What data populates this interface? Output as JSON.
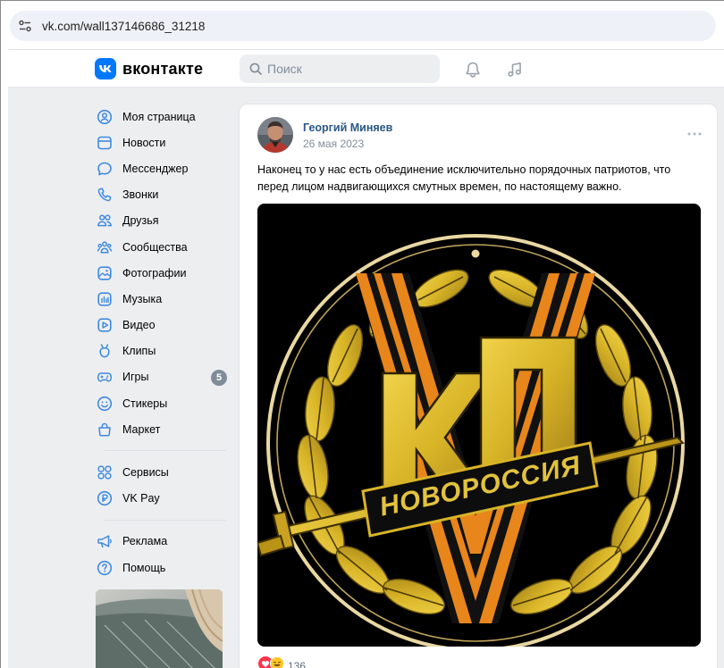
{
  "browser": {
    "url": "vk.com/wall137146686_31218"
  },
  "header": {
    "logo_text": "вконтакте",
    "search_placeholder": "Поиск"
  },
  "sidebar": {
    "items": [
      {
        "label": "Моя страница",
        "icon": "user-circle-icon"
      },
      {
        "label": "Новости",
        "icon": "news-icon"
      },
      {
        "label": "Мессенджер",
        "icon": "message-icon"
      },
      {
        "label": "Звонки",
        "icon": "phone-icon"
      },
      {
        "label": "Друзья",
        "icon": "friends-icon"
      },
      {
        "label": "Сообщества",
        "icon": "communities-icon"
      },
      {
        "label": "Фотографии",
        "icon": "photo-icon"
      },
      {
        "label": "Музыка",
        "icon": "music-icon"
      },
      {
        "label": "Видео",
        "icon": "video-icon"
      },
      {
        "label": "Клипы",
        "icon": "clips-icon"
      },
      {
        "label": "Игры",
        "icon": "gamepad-icon",
        "badge": "5"
      },
      {
        "label": "Стикеры",
        "icon": "smile-icon"
      },
      {
        "label": "Маркет",
        "icon": "bag-icon"
      }
    ],
    "items2": [
      {
        "label": "Сервисы",
        "icon": "services-icon"
      },
      {
        "label": "VK Pay",
        "icon": "ruble-icon"
      }
    ],
    "items3": [
      {
        "label": "Реклама",
        "icon": "megaphone-icon"
      },
      {
        "label": "Помощь",
        "icon": "help-icon"
      }
    ]
  },
  "post": {
    "author": "Георгий Миняев",
    "date": "26 мая 2023",
    "text": "Наконец то у нас есть объединение исключительно порядочных патриотов, что перед лицом надвигающихся смутных времен, по настоящему важно.",
    "image": {
      "emblem_letters": "КП",
      "ribbon_text": "НОВОРОССИЯ"
    },
    "reactions_count": "136"
  },
  "colors": {
    "vk_blue": "#0077ff",
    "link": "#2a5885",
    "muted": "#818c99",
    "background": "#edeef0",
    "emblem_gold": "#d8b427",
    "ribbon_orange": "#e8861b"
  }
}
